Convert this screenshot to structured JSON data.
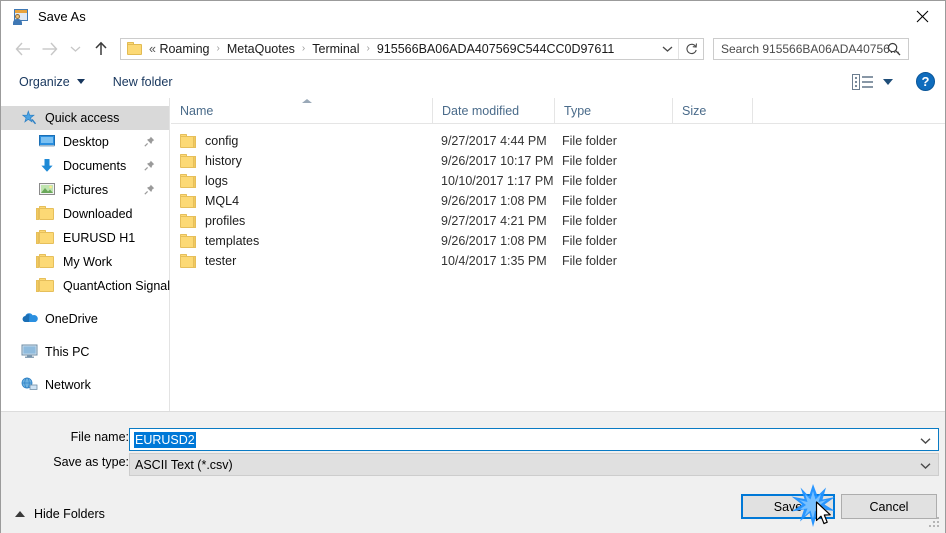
{
  "window": {
    "title": "Save As",
    "title_icon": "save-as-icon",
    "close_label": "✕"
  },
  "nav": {
    "back_icon": "arrow-left-icon",
    "forward_icon": "arrow-right-icon",
    "recent_icon": "chevron-down-icon",
    "up_icon": "arrow-up-icon",
    "address": {
      "folder_icon": "folder-icon",
      "ellipsis": "«",
      "crumbs": [
        "Roaming",
        "MetaQuotes",
        "Terminal",
        "915566BA06ADA407569C544CC0D97611"
      ],
      "separator": "›",
      "dropdown_icon": "chevron-down-icon",
      "refresh_icon": "refresh-icon"
    },
    "search": {
      "placeholder": "Search 915566BA06ADA40756...",
      "icon": "search-icon"
    }
  },
  "toolbar": {
    "organize_label": "Organize",
    "new_folder_label": "New folder",
    "view_icon": "view-layout-icon",
    "view_caret_icon": "chevron-down-icon",
    "help_label": "?",
    "help_icon": "help-icon"
  },
  "sidebar": {
    "items": [
      {
        "label": "Quick access",
        "icon": "star-pin-icon",
        "selected": true,
        "indent": false,
        "pinned": false
      },
      {
        "label": "Desktop",
        "icon": "desktop-icon",
        "selected": false,
        "indent": true,
        "pinned": true
      },
      {
        "label": "Documents",
        "icon": "documents-icon",
        "selected": false,
        "indent": true,
        "pinned": true
      },
      {
        "label": "Pictures",
        "icon": "pictures-icon",
        "selected": false,
        "indent": true,
        "pinned": true
      },
      {
        "label": "Downloaded",
        "icon": "folder-icon",
        "selected": false,
        "indent": true,
        "pinned": false
      },
      {
        "label": "EURUSD H1",
        "icon": "folder-icon",
        "selected": false,
        "indent": true,
        "pinned": false
      },
      {
        "label": "My Work",
        "icon": "folder-icon",
        "selected": false,
        "indent": true,
        "pinned": false
      },
      {
        "label": "QuantAction Signal",
        "icon": "folder-icon",
        "selected": false,
        "indent": true,
        "pinned": false
      },
      {
        "label": "OneDrive",
        "icon": "onedrive-icon",
        "selected": false,
        "indent": false,
        "pinned": false
      },
      {
        "label": "This PC",
        "icon": "this-pc-icon",
        "selected": false,
        "indent": false,
        "pinned": false
      },
      {
        "label": "Network",
        "icon": "network-icon",
        "selected": false,
        "indent": false,
        "pinned": false
      }
    ]
  },
  "filelist": {
    "columns": [
      {
        "label": "Name",
        "sorted": true,
        "sort_dir": "asc"
      },
      {
        "label": "Date modified",
        "sorted": false
      },
      {
        "label": "Type",
        "sorted": false
      },
      {
        "label": "Size",
        "sorted": false
      }
    ],
    "rows": [
      {
        "name": "config",
        "date": "9/27/2017 4:44 PM",
        "type": "File folder",
        "size": "",
        "icon": "folder-icon"
      },
      {
        "name": "history",
        "date": "9/26/2017 10:17 PM",
        "type": "File folder",
        "size": "",
        "icon": "folder-icon"
      },
      {
        "name": "logs",
        "date": "10/10/2017 1:17 PM",
        "type": "File folder",
        "size": "",
        "icon": "folder-icon"
      },
      {
        "name": "MQL4",
        "date": "9/26/2017 1:08 PM",
        "type": "File folder",
        "size": "",
        "icon": "folder-icon"
      },
      {
        "name": "profiles",
        "date": "9/27/2017 4:21 PM",
        "type": "File folder",
        "size": "",
        "icon": "folder-icon"
      },
      {
        "name": "templates",
        "date": "9/26/2017 1:08 PM",
        "type": "File folder",
        "size": "",
        "icon": "folder-icon"
      },
      {
        "name": "tester",
        "date": "10/4/2017 1:35 PM",
        "type": "File folder",
        "size": "",
        "icon": "folder-icon"
      }
    ]
  },
  "form": {
    "file_name_label": "File name:",
    "file_name_value": "EURUSD2",
    "save_as_type_label": "Save as type:",
    "save_as_type_value": "ASCII Text (*.csv)",
    "dropdown_icon": "chevron-down-icon"
  },
  "footer": {
    "hide_folders_label": "Hide Folders",
    "hide_folders_icon": "chevron-up-icon",
    "save_label": "Save",
    "cancel_label": "Cancel",
    "resize_grip_icon": "resize-grip-icon",
    "cursor_icon": "mouse-cursor-icon",
    "click_effect_icon": "click-burst-icon"
  },
  "colors": {
    "accent": "#0078d7",
    "focus_border": "#0a7bc4",
    "folder_yellow": "#fcd975",
    "header_text": "#4a6b8a",
    "toolbar_text": "#17365d",
    "selection_bg": "#d9d9d9",
    "panel_bg": "#f0f0f0"
  }
}
